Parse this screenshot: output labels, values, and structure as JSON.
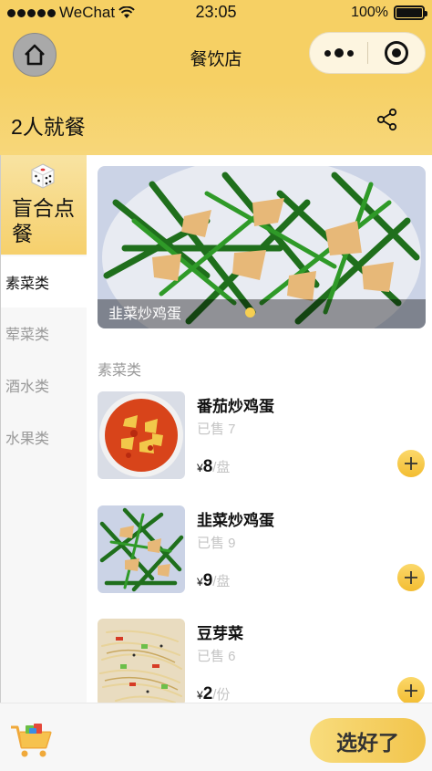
{
  "status_bar": {
    "carrier": "WeChat",
    "time": "23:05",
    "battery": "100%"
  },
  "nav": {
    "title": "餐饮店"
  },
  "header": {
    "title": "2人就餐"
  },
  "sidebar": {
    "blind_box_label": "盲合点餐",
    "categories": [
      {
        "label": "素菜类",
        "active": true
      },
      {
        "label": "荤菜类",
        "active": false
      },
      {
        "label": "酒水类",
        "active": false
      },
      {
        "label": "水果类",
        "active": false
      }
    ]
  },
  "banner": {
    "caption": "韭菜炒鸡蛋"
  },
  "section": {
    "title": "素菜类"
  },
  "dishes": [
    {
      "name": "番茄炒鸡蛋",
      "sold": "已售 7",
      "currency": "¥",
      "price": "8",
      "unit": "/盘"
    },
    {
      "name": "韭菜炒鸡蛋",
      "sold": "已售 9",
      "currency": "¥",
      "price": "9",
      "unit": "/盘"
    },
    {
      "name": "豆芽菜",
      "sold": "已售 6",
      "currency": "¥",
      "price": "2",
      "unit": "/份"
    }
  ],
  "bottom": {
    "checkout_label": "选好了"
  },
  "colors": {
    "accent": "#f6d064",
    "button_yellow": "#f3bd32",
    "muted": "#999999"
  },
  "icons": [
    "signal-dots-icon",
    "wifi-icon",
    "battery-icon",
    "home-icon",
    "more-icon",
    "close-ring-icon",
    "share-icon",
    "dice-icon",
    "add-icon",
    "cart-icon"
  ]
}
